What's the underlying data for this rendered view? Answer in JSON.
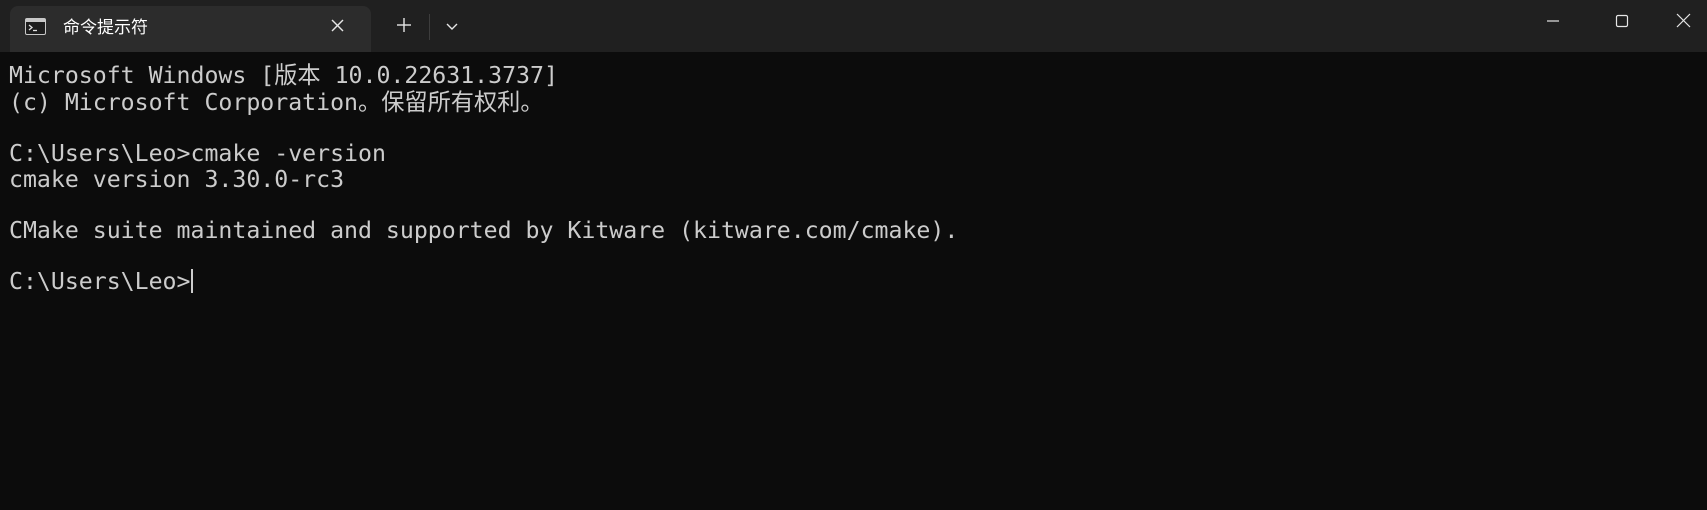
{
  "window": {
    "tab_title": "命令提示符",
    "tab_icon": "cmd-terminal-icon",
    "buttons": {
      "close_tab": "close-icon",
      "new_tab": "plus-icon",
      "dropdown": "chevron-down-icon",
      "minimize": "minimize-icon",
      "maximize": "maximize-icon",
      "close_window": "close-icon"
    }
  },
  "terminal": {
    "lines": [
      "Microsoft Windows [版本 10.0.22631.3737]",
      "(c) Microsoft Corporation。保留所有权利。",
      "",
      "C:\\Users\\Leo>cmake -version",
      "cmake version 3.30.0-rc3",
      "",
      "CMake suite maintained and supported by Kitware (kitware.com/cmake).",
      "",
      "C:\\Users\\Leo>"
    ]
  },
  "colors": {
    "background": "#0c0c0c",
    "foreground": "#cccccc",
    "titlebar": "#202020",
    "active_tab": "#2c2c2c"
  }
}
